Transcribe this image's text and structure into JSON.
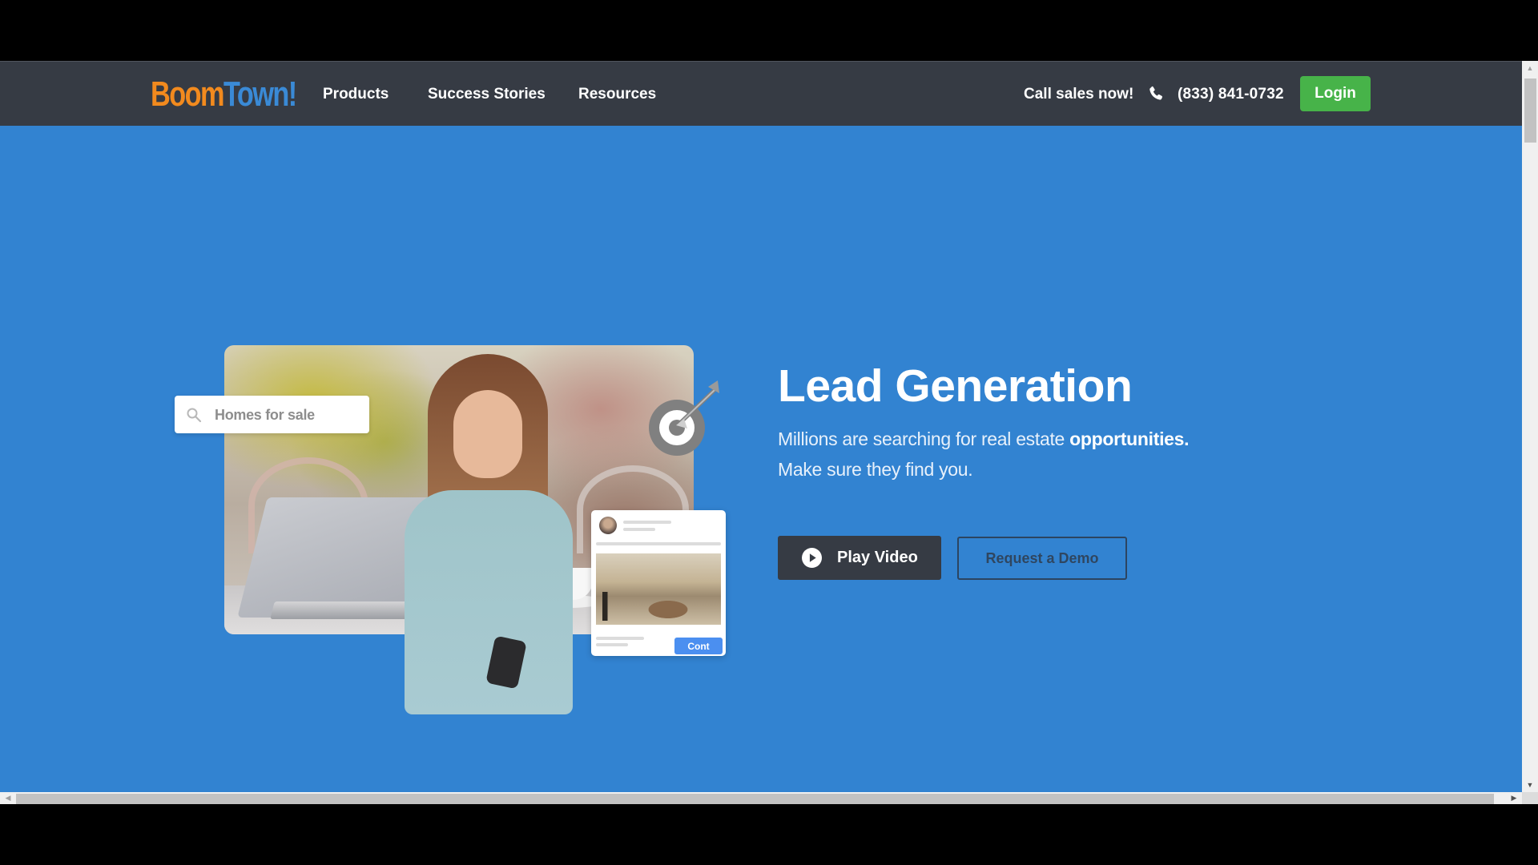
{
  "nav": {
    "logo": {
      "part1": "Boom",
      "part2": "Town!"
    },
    "links": [
      {
        "label": "Products"
      },
      {
        "label": "Success Stories"
      },
      {
        "label": "Resources"
      }
    ],
    "call_text": "Call sales now!",
    "phone_icon": "phone-icon",
    "phone_number": "(833) 841-0732",
    "login_label": "Login"
  },
  "hero": {
    "title": "Lead Generation",
    "subtitle_line1_regular": "Millions are searching for real estate ",
    "subtitle_line1_bold": "opportunities.",
    "subtitle_line2": "Make sure they find you.",
    "play_button_label": "Play Video",
    "demo_button_label": "Request a Demo",
    "illustration": {
      "search_placeholder": "Homes for sale",
      "listing_button_label": "Cont",
      "icons": [
        "search-icon",
        "target-icon",
        "avatar"
      ]
    }
  },
  "colors": {
    "nav_bg": "#363b44",
    "hero_bg": "#3283d1",
    "login_bg": "#47b349",
    "logo_orange": "#f28a1e",
    "logo_blue": "#3a8ad6",
    "play_btn_bg": "#363b44",
    "demo_btn_border": "#2c4561"
  }
}
